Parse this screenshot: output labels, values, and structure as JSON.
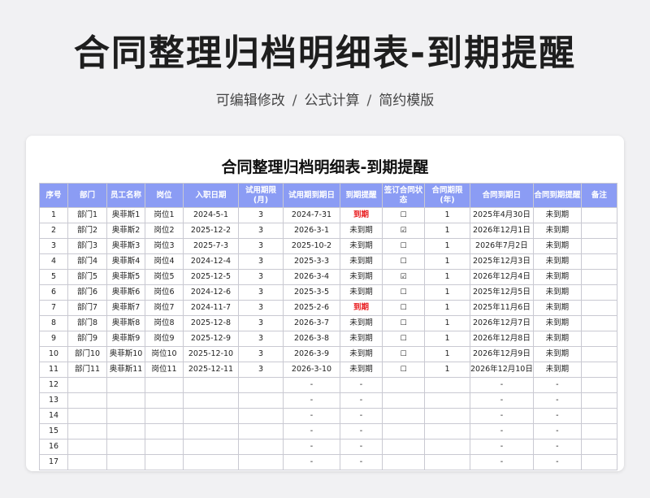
{
  "page": {
    "title": "合同整理归档明细表-到期提醒",
    "subtitle_items": [
      "可编辑修改",
      "公式计算",
      "简约模版"
    ],
    "subtitle_separator": "/"
  },
  "sheet": {
    "title": "合同整理归档明细表-到期提醒",
    "columns": [
      "序号",
      "部门",
      "员工名称",
      "岗位",
      "入职日期",
      "试用期限(月)",
      "试用期到期日",
      "到期提醒",
      "签订合同状态",
      "合同期限(年)",
      "合同到期日",
      "合同到期提醒",
      "备注"
    ],
    "rows": [
      [
        "1",
        "部门1",
        "奥菲斯1",
        "岗位1",
        "2024-5-1",
        "3",
        "2024-7-31",
        "到期",
        "☐",
        "1",
        "2025年4月30日",
        "未到期",
        ""
      ],
      [
        "2",
        "部门2",
        "奥菲斯2",
        "岗位2",
        "2025-12-2",
        "3",
        "2026-3-1",
        "未到期",
        "☑",
        "1",
        "2026年12月1日",
        "未到期",
        ""
      ],
      [
        "3",
        "部门3",
        "奥菲斯3",
        "岗位3",
        "2025-7-3",
        "3",
        "2025-10-2",
        "未到期",
        "☐",
        "1",
        "2026年7月2日",
        "未到期",
        ""
      ],
      [
        "4",
        "部门4",
        "奥菲斯4",
        "岗位4",
        "2024-12-4",
        "3",
        "2025-3-3",
        "未到期",
        "☐",
        "1",
        "2025年12月3日",
        "未到期",
        ""
      ],
      [
        "5",
        "部门5",
        "奥菲斯5",
        "岗位5",
        "2025-12-5",
        "3",
        "2026-3-4",
        "未到期",
        "☑",
        "1",
        "2026年12月4日",
        "未到期",
        ""
      ],
      [
        "6",
        "部门6",
        "奥菲斯6",
        "岗位6",
        "2024-12-6",
        "3",
        "2025-3-5",
        "未到期",
        "☐",
        "1",
        "2025年12月5日",
        "未到期",
        ""
      ],
      [
        "7",
        "部门7",
        "奥菲斯7",
        "岗位7",
        "2024-11-7",
        "3",
        "2025-2-6",
        "到期",
        "☐",
        "1",
        "2025年11月6日",
        "未到期",
        ""
      ],
      [
        "8",
        "部门8",
        "奥菲斯8",
        "岗位8",
        "2025-12-8",
        "3",
        "2026-3-7",
        "未到期",
        "☐",
        "1",
        "2026年12月7日",
        "未到期",
        ""
      ],
      [
        "9",
        "部门9",
        "奥菲斯9",
        "岗位9",
        "2025-12-9",
        "3",
        "2026-3-8",
        "未到期",
        "☐",
        "1",
        "2026年12月8日",
        "未到期",
        ""
      ],
      [
        "10",
        "部门10",
        "奥菲斯10",
        "岗位10",
        "2025-12-10",
        "3",
        "2026-3-9",
        "未到期",
        "☐",
        "1",
        "2026年12月9日",
        "未到期",
        ""
      ],
      [
        "11",
        "部门11",
        "奥菲斯11",
        "岗位11",
        "2025-12-11",
        "3",
        "2026-3-10",
        "未到期",
        "☐",
        "1",
        "2026年12月10日",
        "未到期",
        ""
      ],
      [
        "12",
        "",
        "",
        "",
        "",
        "",
        "-",
        "-",
        "",
        "",
        "-",
        "-",
        ""
      ],
      [
        "13",
        "",
        "",
        "",
        "",
        "",
        "-",
        "-",
        "",
        "",
        "-",
        "-",
        ""
      ],
      [
        "14",
        "",
        "",
        "",
        "",
        "",
        "-",
        "-",
        "",
        "",
        "-",
        "-",
        ""
      ],
      [
        "15",
        "",
        "",
        "",
        "",
        "",
        "-",
        "-",
        "",
        "",
        "-",
        "-",
        ""
      ],
      [
        "16",
        "",
        "",
        "",
        "",
        "",
        "-",
        "-",
        "",
        "",
        "-",
        "-",
        ""
      ],
      [
        "17",
        "",
        "",
        "",
        "",
        "",
        "-",
        "-",
        "",
        "",
        "-",
        "-",
        ""
      ]
    ],
    "due_label": "到期"
  },
  "colors": {
    "header_bg": "#8b9cf4",
    "due_text": "#e8191c",
    "page_bg": "#f1f1f3"
  }
}
